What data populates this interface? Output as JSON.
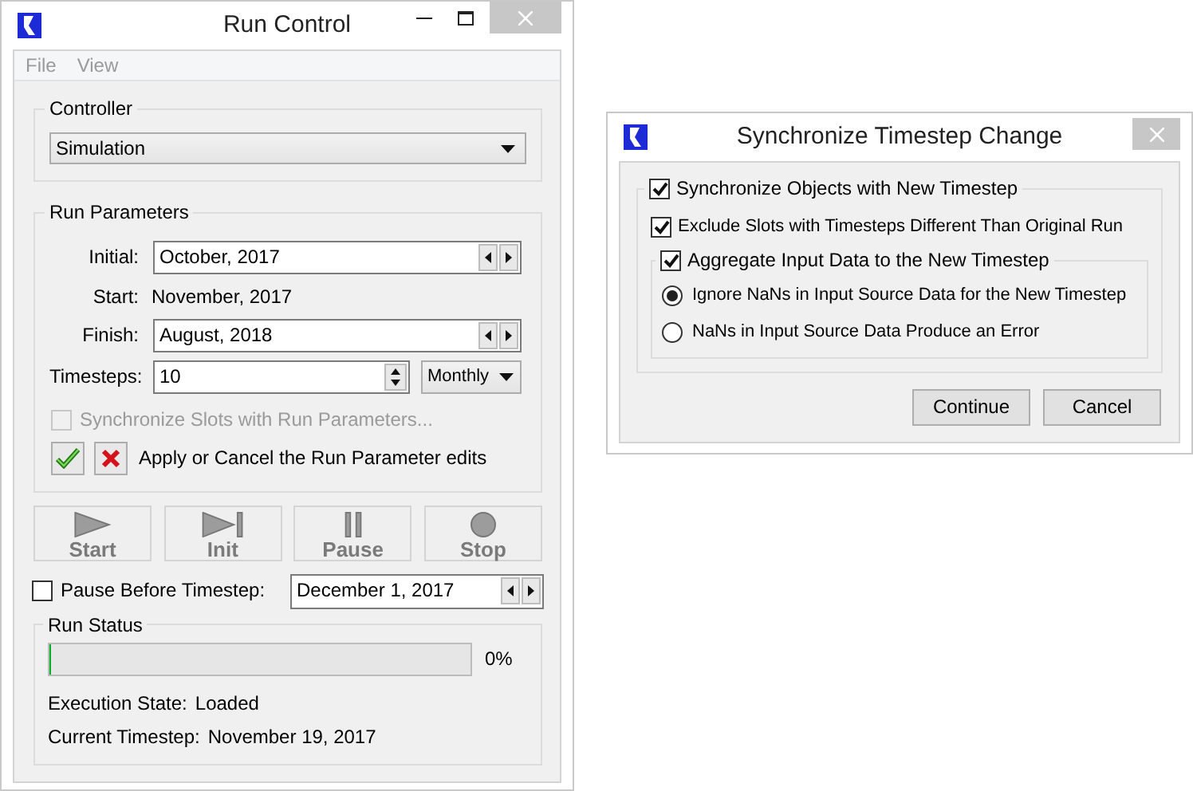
{
  "run_control": {
    "title": "Run Control",
    "menu": [
      "File",
      "View"
    ],
    "controller": {
      "label": "Controller",
      "value": "Simulation"
    },
    "run_parameters": {
      "label": "Run Parameters",
      "fields": [
        {
          "kind": "date",
          "label": "Initial:",
          "value": "October, 2017"
        },
        {
          "kind": "text",
          "label": "Start:",
          "value": "November, 2017"
        },
        {
          "kind": "date",
          "label": "Finish:",
          "value": "August, 2018"
        },
        {
          "kind": "spin",
          "label": "Timesteps:",
          "value": "10",
          "unit": "Monthly"
        }
      ],
      "sync_slots": {
        "label": "Synchronize Slots with Run Parameters...",
        "checked": false,
        "disabled": true
      },
      "apply_text": "Apply or Cancel the Run Parameter edits"
    },
    "buttons": [
      {
        "kind": "start",
        "label": "Start"
      },
      {
        "kind": "init",
        "label": "Init"
      },
      {
        "kind": "pause",
        "label": "Pause"
      },
      {
        "kind": "stop",
        "label": "Stop"
      }
    ],
    "pause_before": {
      "label": "Pause Before Timestep:",
      "checked": false,
      "value": "December 1, 2017"
    },
    "run_status": {
      "label": "Run Status",
      "level": 0,
      "reading": "0%",
      "execution_state": {
        "label": "Execution State:",
        "value": "Loaded"
      },
      "current_timestep": {
        "label": "Current Timestep:",
        "value": "November 19, 2017"
      }
    }
  },
  "sync_dialog": {
    "title": "Synchronize Timestep Change",
    "synchronize": {
      "label": "Synchronize Objects with New Timestep",
      "checked": true
    },
    "exclude": {
      "label": "Exclude Slots with Timesteps Different Than Original Run",
      "checked": true
    },
    "aggregate": {
      "label": "Aggregate Input Data to the New Timestep",
      "checked": true,
      "options": [
        {
          "label": "Ignore NaNs in Input Source Data for the New Timestep",
          "selected": true
        },
        {
          "label": "NaNs in Input Source Data Produce an Error",
          "selected": false
        }
      ]
    },
    "buttons": [
      "Continue",
      "Cancel"
    ]
  }
}
